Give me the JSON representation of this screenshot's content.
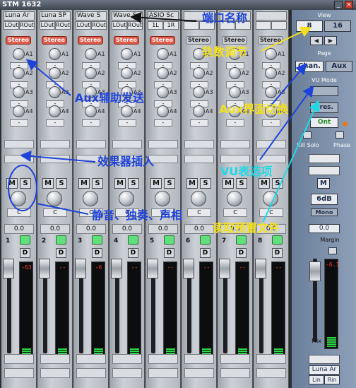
{
  "window": {
    "title": "STM 1632",
    "minimize_glyph": "_",
    "close_glyph": "×"
  },
  "strip_labels": {
    "stereo": "Stereo",
    "aux": [
      "A1",
      "A2",
      "A3",
      "A4"
    ],
    "dash": "-",
    "mute": "M",
    "solo": "S",
    "pan": "C",
    "direct": "D"
  },
  "channels": [
    {
      "number": "1",
      "port": "Luna Ar",
      "out_l": "LOut",
      "out_r": "ROut",
      "stereo_on": true,
      "gain": "0.0",
      "meter": "-63"
    },
    {
      "number": "2",
      "port": "Luna SP",
      "out_l": "LOut",
      "out_r": "ROut",
      "stereo_on": true,
      "gain": "0.0",
      "meter": "--"
    },
    {
      "number": "3",
      "port": "Wave S",
      "out_l": "LOut",
      "out_r": "ROut",
      "stereo_on": true,
      "gain": "0.0",
      "meter": "-6"
    },
    {
      "number": "4",
      "port": "Wave S",
      "out_l": "LOut",
      "out_r": "ROut",
      "stereo_on": true,
      "gain": "0.0",
      "meter": "--"
    },
    {
      "number": "5",
      "port": "ASIO Sc",
      "out_l": "1L",
      "out_r": "1R",
      "stereo_on": true,
      "gain": "0.0",
      "meter": "--"
    },
    {
      "number": "6",
      "port": "",
      "out_l": "",
      "out_r": "",
      "stereo_on": false,
      "gain": "0.0",
      "meter": "--"
    },
    {
      "number": "7",
      "port": "",
      "out_l": "",
      "out_r": "",
      "stereo_on": false,
      "gain": "0.0",
      "meter": "--"
    },
    {
      "number": "8",
      "port": "",
      "out_l": "",
      "out_r": "",
      "stereo_on": false,
      "gain": "0.0",
      "meter": "--"
    }
  ],
  "panel": {
    "view_label": "View",
    "view_8": "8",
    "view_16": "16",
    "prev_glyph": "◀",
    "next_glyph": "▶",
    "page_label": "Page",
    "chan_button": "Chan.",
    "aux_button": "Aux",
    "vu_mode_label": "VU Mode",
    "pres_button": "Pres.",
    "ont_button": "Ont",
    "kill_solo_label": "Kill Solo",
    "phase_label": "Phase",
    "m_button": "M",
    "db_value": "6dB",
    "mono_button": "Mono",
    "master_gain": "0.0",
    "margin_label": "Margin",
    "master_meter": "-6.1",
    "mix_label": "Mix",
    "input_port": "Luna Ar",
    "in_l": "Lin",
    "in_r": "Rin"
  },
  "annotations": {
    "port_name": "端口名称",
    "track_count": "轨数调节",
    "aux_send": "Aux辅助发送",
    "aux_switch": "Aux界面切换",
    "fx_insert": "效果器插入",
    "vu_option": "VU表选项",
    "mute_solo_pan": "静音、独奏、声相",
    "load_preset": "读取预置文件"
  }
}
